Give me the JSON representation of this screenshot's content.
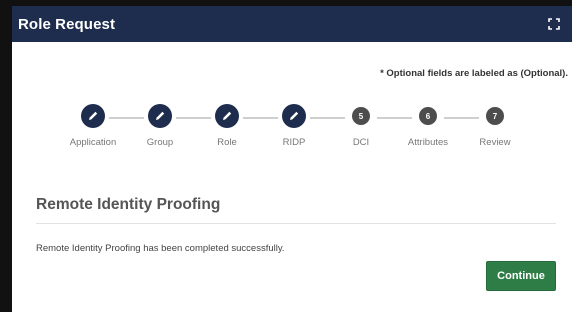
{
  "dialog": {
    "title": "Role Request",
    "expand_icon": "expand-icon"
  },
  "optional_note": "* Optional fields are labeled as (Optional).",
  "stepper": {
    "steps": [
      {
        "label": "Application",
        "status": "completed",
        "icon": "pencil-icon",
        "number": ""
      },
      {
        "label": "Group",
        "status": "completed",
        "icon": "pencil-icon",
        "number": ""
      },
      {
        "label": "Role",
        "status": "completed",
        "icon": "pencil-icon",
        "number": ""
      },
      {
        "label": "RIDP",
        "status": "completed",
        "icon": "pencil-icon",
        "number": ""
      },
      {
        "label": "DCI",
        "status": "pending",
        "icon": "",
        "number": "5"
      },
      {
        "label": "Attributes",
        "status": "pending",
        "icon": "",
        "number": "6"
      },
      {
        "label": "Review",
        "status": "pending",
        "icon": "",
        "number": "7"
      }
    ]
  },
  "section": {
    "title": "Remote Identity Proofing",
    "message": "Remote Identity Proofing has been completed successfully."
  },
  "actions": {
    "continue_label": "Continue"
  },
  "colors": {
    "header_bg": "#1e2d4d",
    "completed_step": "#1e2d4d",
    "pending_step": "#4d4d4d",
    "continue_button": "#2e7d47"
  }
}
